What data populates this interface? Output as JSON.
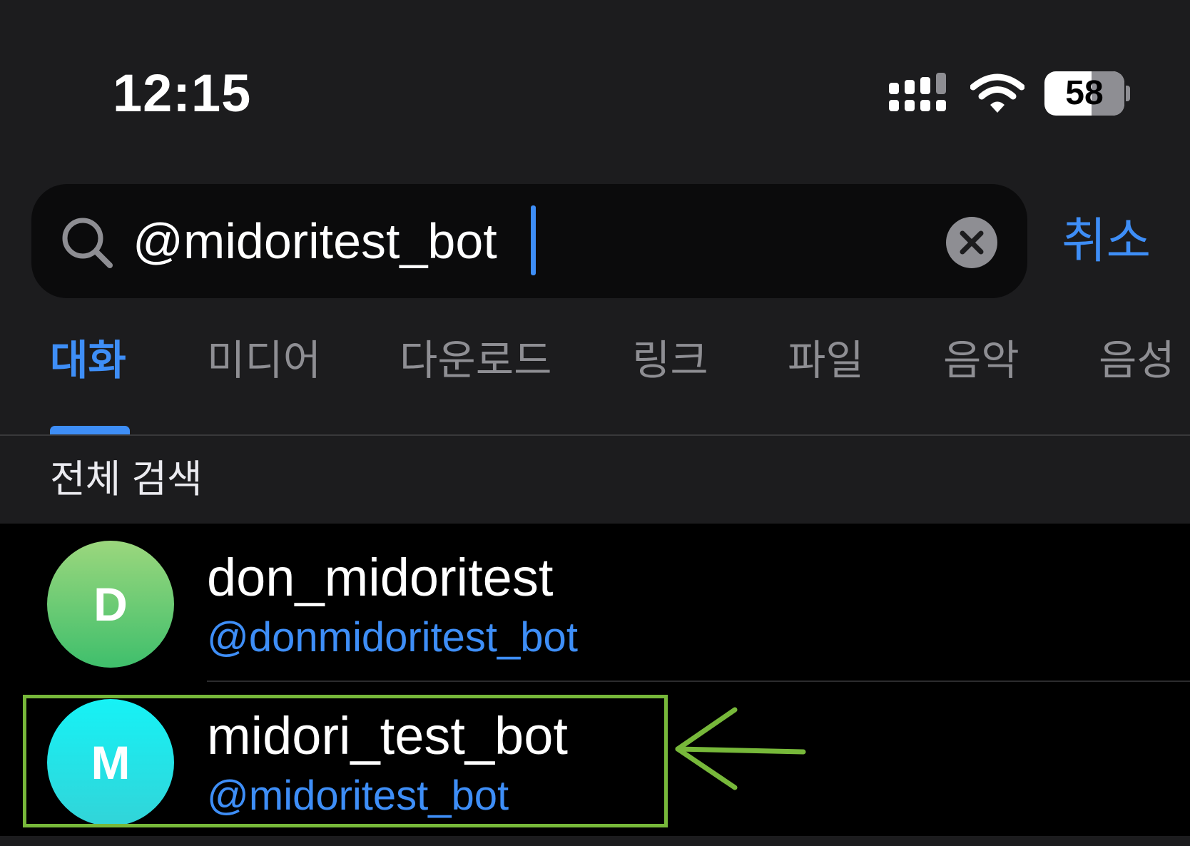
{
  "status_bar": {
    "time": "12:15",
    "battery_level": "58"
  },
  "search": {
    "query": "@midoritest_bot",
    "cancel_label": "취소"
  },
  "tabs": [
    {
      "label": "대화",
      "active": true
    },
    {
      "label": "미디어",
      "active": false
    },
    {
      "label": "다운로드",
      "active": false
    },
    {
      "label": "링크",
      "active": false
    },
    {
      "label": "파일",
      "active": false
    },
    {
      "label": "음악",
      "active": false
    },
    {
      "label": "음성",
      "active": false
    }
  ],
  "section_header": "전체 검색",
  "results": [
    {
      "initial": "D",
      "name": "don_midoritest",
      "username": "@donmidoritest_bot",
      "avatar_gradient": [
        "#9bd77d",
        "#3fbf6c"
      ]
    },
    {
      "initial": "M",
      "name": "midori_test_bot",
      "username": "@midoritest_bot",
      "avatar_gradient": [
        "#16f2f6",
        "#32d4d8"
      ]
    }
  ],
  "colors": {
    "accent": "#3e8ef7",
    "background": "#1c1c1e",
    "search_field": "#0b0b0c",
    "results_background": "#000000",
    "annotation": "#77b83a"
  },
  "icons": {
    "signal": "cellular-signal-icon",
    "wifi": "wifi-icon",
    "search": "search-icon",
    "clear": "clear-x-icon",
    "annotation": "arrow-left-icon"
  }
}
